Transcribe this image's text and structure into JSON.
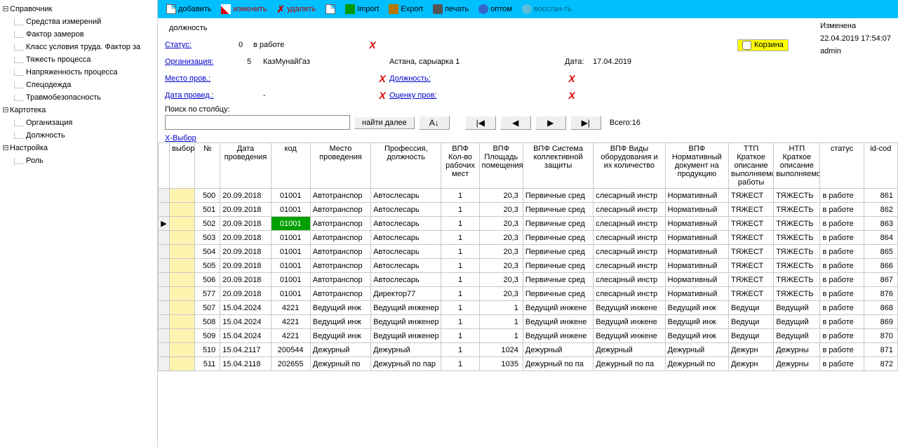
{
  "sidebar": {
    "nodes": [
      {
        "label": "Справочник",
        "expanded": true,
        "children": [
          "Средства измерений",
          "Фактор замеров",
          "Класс условия труда. Фактор за",
          "Тяжесть процесса",
          "Напряженность процесса",
          "Спецодежда",
          "Травмобезопасность"
        ]
      },
      {
        "label": "Картотека",
        "expanded": true,
        "children": [
          "Организация",
          "Должность"
        ]
      },
      {
        "label": "Настройка",
        "expanded": true,
        "children": [
          "Роль"
        ]
      }
    ]
  },
  "toolbar": {
    "add": "добавить",
    "edit": "изменить",
    "delete": "удалить",
    "import": "Import",
    "export": "Export",
    "print": "печать",
    "opt": "оптом",
    "restore": "восстан-ть"
  },
  "form": {
    "title": "должность",
    "status_lbl": "Статус:",
    "status_val": "0",
    "status_text": "в работе",
    "org_lbl": "Организация:",
    "org_val": "5",
    "org_name": "КазМунайГаз",
    "org_addr": "Астана, сарыарка 1",
    "date_lbl": "Дата:",
    "date_val": "17.04.2019",
    "mesto_lbl": "Место пров.:",
    "dolzh_lbl": "Должность:",
    "dataprov_lbl": "Дата провед.:",
    "dataprov_val": "-",
    "ocenka_lbl": "Оценку пров:",
    "korzina_lbl": "Корзина",
    "search_lbl": "Поиск по столбцу:",
    "find_next": "найти далее",
    "sort_az": "A↓Я",
    "total_lbl": "Всего:",
    "total_n": "16",
    "xvybor": "X-Выбор"
  },
  "meta": {
    "changed_lbl": "Изменена",
    "changed_at": "22.04.2019 17:54:07",
    "user": "admin"
  },
  "grid": {
    "headers": [
      "",
      "выбор",
      "№",
      "Дата проведения",
      "код",
      "Место проведения",
      "Профессия, должность",
      "ВПФ Кол-во рабочих мест",
      "ВПФ Площадь помещения",
      "ВПФ Система коллективной защиты",
      "ВПФ Виды оборудования и их количество",
      "ВПФ Нормативный документ на продукцию",
      "ТТП Краткое описание выполняемой работы",
      "НТП Краткое описание выполняемой",
      "статус",
      "id-cod"
    ],
    "rows": [
      {
        "mark": "",
        "no": "500",
        "date": "20.09.2018",
        "kod": "01001",
        "mesto": "Автотранспор",
        "prof": "Автослесарь",
        "v1": "1",
        "v2": "20,3",
        "v3": "Первичные сред",
        "v4": "слесарный инстр",
        "v5": "Нормативный",
        "ttp": "ТЯЖЕСТ",
        "ntp": "ТЯЖЕСТЬ",
        "status": "в работе",
        "id": "861"
      },
      {
        "mark": "",
        "no": "501",
        "date": "20.09.2018",
        "kod": "01001",
        "mesto": "Автотранспор",
        "prof": "Автослесарь",
        "v1": "1",
        "v2": "20,3",
        "v3": "Первичные сред",
        "v4": "слесарный инстр",
        "v5": "Нормативный",
        "ttp": "ТЯЖЕСТ",
        "ntp": "ТЯЖЕСТЬ",
        "status": "в работе",
        "id": "862"
      },
      {
        "mark": "▶",
        "no": "502",
        "date": "20.09.2018",
        "kod": "01001",
        "kod_hl": true,
        "mesto": "Автотранспор",
        "prof": "Автослесарь",
        "v1": "1",
        "v2": "20,3",
        "v3": "Первичные сред",
        "v4": "слесарный инстр",
        "v5": "Нормативный",
        "ttp": "ТЯЖЕСТ",
        "ntp": "ТЯЖЕСТЬ",
        "status": "в работе",
        "id": "863"
      },
      {
        "mark": "",
        "no": "503",
        "date": "20.09.2018",
        "kod": "01001",
        "mesto": "Автотранспор",
        "prof": "Автослесарь",
        "v1": "1",
        "v2": "20,3",
        "v3": "Первичные сред",
        "v4": "слесарный инстр",
        "v5": "Нормативный",
        "ttp": "ТЯЖЕСТ",
        "ntp": "ТЯЖЕСТЬ",
        "status": "в работе",
        "id": "864"
      },
      {
        "mark": "",
        "no": "504",
        "date": "20.09.2018",
        "kod": "01001",
        "mesto": "Автотранспор",
        "prof": "Автослесарь",
        "v1": "1",
        "v2": "20,3",
        "v3": "Первичные сред",
        "v4": "слесарный инстр",
        "v5": "Нормативный",
        "ttp": "ТЯЖЕСТ",
        "ntp": "ТЯЖЕСТЬ",
        "status": "в работе",
        "id": "865"
      },
      {
        "mark": "",
        "no": "505",
        "date": "20.09.2018",
        "kod": "01001",
        "mesto": "Автотранспор",
        "prof": "Автослесарь",
        "v1": "1",
        "v2": "20,3",
        "v3": "Первичные сред",
        "v4": "слесарный инстр",
        "v5": "Нормативный",
        "ttp": "ТЯЖЕСТ",
        "ntp": "ТЯЖЕСТЬ",
        "status": "в работе",
        "id": "866"
      },
      {
        "mark": "",
        "no": "506",
        "date": "20.09.2018",
        "kod": "01001",
        "mesto": "Автотранспор",
        "prof": "Автослесарь",
        "v1": "1",
        "v2": "20,3",
        "v3": "Первичные сред",
        "v4": "слесарный инстр",
        "v5": "Нормативный",
        "ttp": "ТЯЖЕСТ",
        "ntp": "ТЯЖЕСТЬ",
        "status": "в работе",
        "id": "867"
      },
      {
        "mark": "",
        "no": "577",
        "date": "20.09.2018",
        "kod": "01001",
        "mesto": "Автотранспор",
        "prof": "Директор77",
        "v1": "1",
        "v2": "20,3",
        "v3": "Первичные сред",
        "v4": "слесарный инстр",
        "v5": "Нормативный",
        "ttp": "ТЯЖЕСТ",
        "ntp": "ТЯЖЕСТЬ",
        "status": "в работе",
        "id": "876"
      },
      {
        "mark": "",
        "no": "507",
        "date": "15.04.2024",
        "kod": "4221",
        "mesto": "Ведущий инж",
        "prof": "Ведущий инженер",
        "v1": "1",
        "v2": "1",
        "v3": "Ведущий инжене",
        "v4": "Ведущий инжене",
        "v5": "Ведущий инж",
        "ttp": "Ведущи",
        "ntp": "Ведущий",
        "status": "в работе",
        "id": "868"
      },
      {
        "mark": "",
        "no": "508",
        "date": "15.04.2024",
        "kod": "4221",
        "mesto": "Ведущий инж",
        "prof": "Ведущий инженер",
        "v1": "1",
        "v2": "1",
        "v3": "Ведущий инжене",
        "v4": "Ведущий инжене",
        "v5": "Ведущий инж",
        "ttp": "Ведущи",
        "ntp": "Ведущий",
        "status": "в работе",
        "id": "869"
      },
      {
        "mark": "",
        "no": "509",
        "date": "15.04.2024",
        "kod": "4221",
        "mesto": "Ведущий инж",
        "prof": "Ведущий инженер",
        "v1": "1",
        "v2": "1",
        "v3": "Ведущий инжене",
        "v4": "Ведущий инжене",
        "v5": "Ведущий инж",
        "ttp": "Ведущи",
        "ntp": "Ведущий",
        "status": "в работе",
        "id": "870"
      },
      {
        "mark": "",
        "no": "510",
        "date": "15.04.2117",
        "kod": "200544",
        "mesto": "Дежурный",
        "prof": "Дежурный",
        "v1": "1",
        "v2": "1024",
        "v3": "Дежурный",
        "v4": "Дежурный",
        "v5": "Дежурный",
        "ttp": "Дежурн",
        "ntp": "Дежурны",
        "status": "в работе",
        "id": "871"
      },
      {
        "mark": "",
        "no": "511",
        "date": "15.04.2118",
        "kod": "202655",
        "mesto": "Дежурный по",
        "prof": "Дежурный по пар",
        "v1": "1",
        "v2": "1035",
        "v3": "Дежурный по па",
        "v4": "Дежурный по па",
        "v5": "Дежурный по",
        "ttp": "Дежурн",
        "ntp": "Дежурны",
        "status": "в работе",
        "id": "872"
      }
    ]
  }
}
